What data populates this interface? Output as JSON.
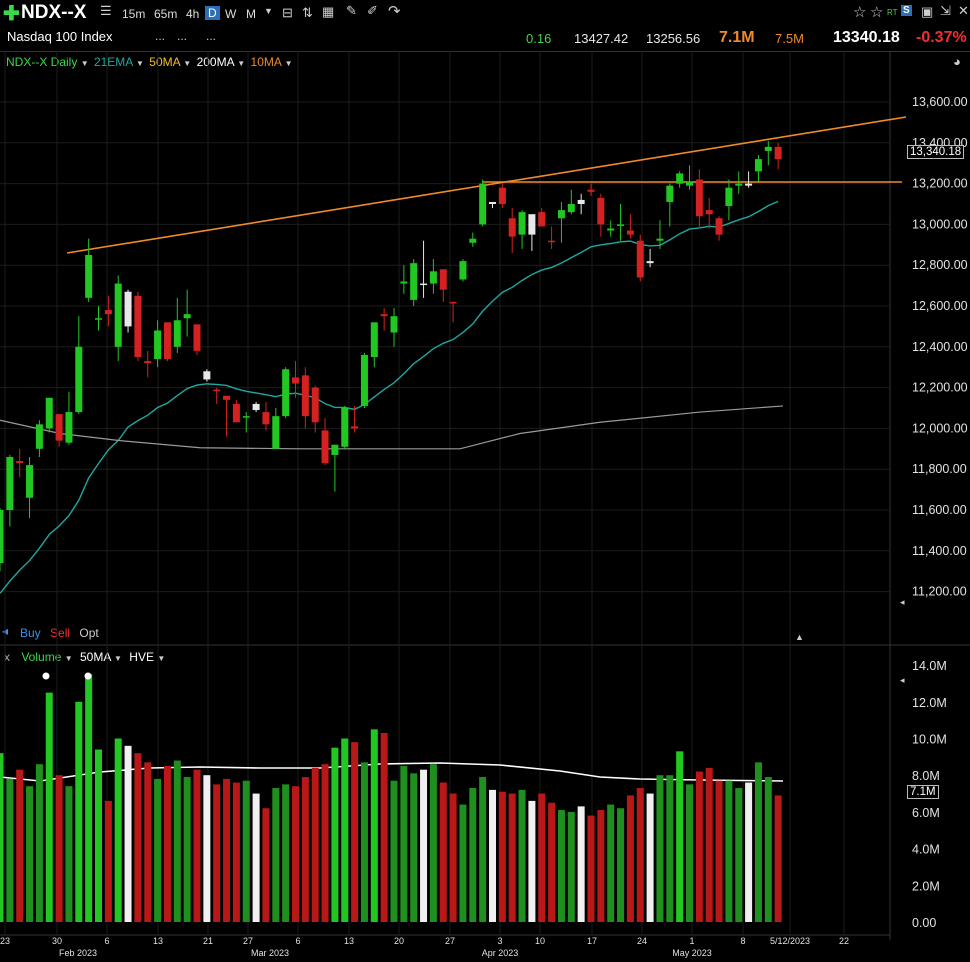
{
  "header": {
    "symbol": "NDX--X",
    "name": "Nasdaq 100 Index",
    "timeframes": [
      "15m",
      "65m",
      "4h",
      "D",
      "W",
      "M"
    ],
    "selected_timeframe": "D",
    "dots": [
      "...",
      "...",
      "..."
    ],
    "change_small": "0.16",
    "high": "13427.42",
    "low": "13256.56",
    "volume_today": "7.1M",
    "volume_avg": "7.5M",
    "last": "13340.18",
    "pct_change": "-0.37%",
    "right_icons": [
      "RT",
      "S"
    ]
  },
  "legend": {
    "symbol_label": "NDX--X Daily",
    "ma21": "21EMA",
    "ma50": "50MA",
    "ma200": "200MA",
    "ma10": "10MA"
  },
  "trade": {
    "buy": "Buy",
    "sell": "Sell",
    "opt": "Opt"
  },
  "volume_legend": {
    "close": "x",
    "volume": "Volume",
    "ma": "50MA",
    "hve": "HVE"
  },
  "price_tag": "13,340.18",
  "volume_tag": "7.1M",
  "chart_data": {
    "type": "candlestick",
    "y_ticks": [
      "13,600.00",
      "13,400.00",
      "13,200.00",
      "13,000.00",
      "12,800.00",
      "12,600.00",
      "12,400.00",
      "12,200.00",
      "12,000.00",
      "11,800.00",
      "11,600.00",
      "11,400.00",
      "11,200.00"
    ],
    "volume_ticks": [
      "14.0M",
      "12.0M",
      "10.0M",
      "8.0M",
      "6.0M",
      "4.0M",
      "2.0M",
      "0.00"
    ],
    "x_labels": [
      "23",
      "30",
      "6",
      "13",
      "21",
      "27",
      "6",
      "13",
      "20",
      "27",
      "3",
      "10",
      "17",
      "24",
      "1",
      "8",
      "5/12/2023",
      "22"
    ],
    "month_labels": [
      "Feb 2023",
      "Mar 2023",
      "Apr 2023",
      "May 2023"
    ],
    "colors": {
      "up": "#22c822",
      "down": "#d42222",
      "neutral": "#e8e8e8",
      "ema21": "#1fa7a0",
      "ma200": "#9a9a9a",
      "trendline": "#f08a2a",
      "vol_up": "#1f8f1f",
      "vol_down": "#b81818",
      "vol_ma": "#ffffff"
    },
    "candles": [
      [
        11340,
        11610,
        11300,
        11600,
        "up",
        9.2
      ],
      [
        11600,
        11870,
        11520,
        11860,
        "up",
        7.8
      ],
      [
        11830,
        11900,
        11760,
        11840,
        "down",
        8.3
      ],
      [
        11660,
        11860,
        11560,
        11820,
        "up",
        7.4
      ],
      [
        11900,
        12040,
        11860,
        12020,
        "up",
        8.6
      ],
      [
        12000,
        12150,
        11980,
        12150,
        "up",
        12.5
      ],
      [
        12070,
        12040,
        11910,
        11940,
        "down",
        8.0
      ],
      [
        11930,
        12180,
        11920,
        12080,
        "up",
        7.4
      ],
      [
        12080,
        12550,
        12070,
        12400,
        "up",
        12.0
      ],
      [
        12640,
        12930,
        12620,
        12850,
        "up",
        13.5
      ],
      [
        12540,
        12600,
        12480,
        12540,
        "up",
        9.4
      ],
      [
        12580,
        12650,
        12500,
        12560,
        "down",
        6.6
      ],
      [
        12710,
        12750,
        12330,
        12400,
        "up",
        10.0
      ],
      [
        12500,
        12680,
        12470,
        12670,
        "neutral",
        9.6
      ],
      [
        12650,
        12670,
        12330,
        12350,
        "down",
        9.2
      ],
      [
        12320,
        12380,
        12250,
        12330,
        "down",
        8.7
      ],
      [
        12340,
        12530,
        12300,
        12480,
        "up",
        7.8
      ],
      [
        12520,
        12520,
        12330,
        12340,
        "down",
        8.5
      ],
      [
        12400,
        12640,
        12370,
        12530,
        "up",
        8.8
      ],
      [
        12560,
        12680,
        12450,
        12540,
        "up",
        7.9
      ],
      [
        12510,
        12490,
        12360,
        12380,
        "down",
        8.3
      ],
      [
        12240,
        12290,
        12230,
        12280,
        "neutral",
        8.0
      ],
      [
        12190,
        12200,
        12120,
        12190,
        "down",
        7.5
      ],
      [
        12140,
        12150,
        11960,
        12160,
        "down",
        7.8
      ],
      [
        12120,
        12140,
        12030,
        12030,
        "down",
        7.6
      ],
      [
        12060,
        12080,
        11980,
        12060,
        "up",
        7.7
      ],
      [
        12120,
        12130,
        12080,
        12090,
        "neutral",
        7.0
      ],
      [
        12020,
        12130,
        11990,
        12080,
        "down",
        6.2
      ],
      [
        11900,
        12100,
        11900,
        12060,
        "up",
        7.3
      ],
      [
        12060,
        12300,
        12050,
        12290,
        "up",
        7.5
      ],
      [
        12250,
        12330,
        12150,
        12220,
        "down",
        7.4
      ],
      [
        12260,
        12300,
        12000,
        12060,
        "down",
        7.9
      ],
      [
        12200,
        12210,
        11980,
        12030,
        "down",
        8.4
      ],
      [
        11990,
        12050,
        11820,
        11830,
        "down",
        8.6
      ],
      [
        11870,
        11920,
        11690,
        11920,
        "up",
        9.5
      ],
      [
        11910,
        12110,
        11900,
        12100,
        "up",
        10.0
      ],
      [
        12010,
        12110,
        11980,
        12000,
        "down",
        9.8
      ],
      [
        12110,
        12370,
        12100,
        12360,
        "up",
        8.7
      ],
      [
        12350,
        12510,
        12300,
        12520,
        "up",
        10.5
      ],
      [
        12550,
        12590,
        12480,
        12560,
        "down",
        10.3
      ],
      [
        12470,
        12590,
        12400,
        12550,
        "up",
        7.7
      ],
      [
        12720,
        12800,
        12660,
        12710,
        "up",
        8.5
      ],
      [
        12630,
        12830,
        12600,
        12810,
        "up",
        8.1
      ],
      [
        12710,
        12920,
        12640,
        12710,
        "neutral",
        8.3
      ],
      [
        12710,
        12830,
        12660,
        12770,
        "up",
        8.6
      ],
      [
        12780,
        12760,
        12620,
        12680,
        "down",
        7.6
      ],
      [
        12620,
        12620,
        12520,
        12620,
        "down",
        7.0
      ],
      [
        12730,
        12830,
        12720,
        12820,
        "up",
        6.4
      ],
      [
        12910,
        12960,
        12890,
        12930,
        "up",
        7.3
      ],
      [
        13000,
        13220,
        12990,
        13200,
        "up",
        7.9
      ],
      [
        13100,
        13110,
        13080,
        13110,
        "neutral",
        7.2
      ],
      [
        13180,
        13200,
        13080,
        13100,
        "down",
        7.1
      ],
      [
        13030,
        13080,
        12860,
        12940,
        "down",
        7.0
      ],
      [
        12950,
        13070,
        12880,
        13060,
        "up",
        7.2
      ],
      [
        12950,
        13010,
        12870,
        13050,
        "neutral",
        6.6
      ],
      [
        13060,
        13080,
        12990,
        12990,
        "down",
        7.0
      ],
      [
        12920,
        12990,
        12880,
        12920,
        "down",
        6.5
      ],
      [
        13070,
        13110,
        12910,
        13030,
        "up",
        6.1
      ],
      [
        13060,
        13170,
        13050,
        13100,
        "up",
        6.0
      ],
      [
        13100,
        13150,
        13050,
        13120,
        "neutral",
        6.3
      ],
      [
        13170,
        13200,
        13140,
        13160,
        "down",
        5.8
      ],
      [
        13130,
        13150,
        12940,
        13000,
        "down",
        6.1
      ],
      [
        12980,
        13020,
        12940,
        12970,
        "up",
        6.4
      ],
      [
        13000,
        13100,
        12920,
        13000,
        "up",
        6.2
      ],
      [
        12970,
        13050,
        12930,
        12950,
        "down",
        6.9
      ],
      [
        12920,
        12950,
        12720,
        12740,
        "down",
        7.3
      ],
      [
        12810,
        12880,
        12790,
        12820,
        "neutral",
        7.0
      ],
      [
        12920,
        13020,
        12880,
        12930,
        "up",
        8.0
      ],
      [
        13110,
        13200,
        12990,
        13190,
        "up",
        8.0
      ],
      [
        13200,
        13260,
        13180,
        13250,
        "up",
        9.3
      ],
      [
        13190,
        13290,
        13170,
        13210,
        "up",
        7.5
      ],
      [
        13220,
        13270,
        12980,
        13040,
        "down",
        8.2
      ],
      [
        13050,
        13130,
        12980,
        13070,
        "down",
        8.4
      ],
      [
        13030,
        13040,
        12920,
        12950,
        "down",
        7.7
      ],
      [
        13090,
        13220,
        13020,
        13180,
        "up",
        7.7
      ],
      [
        13190,
        13260,
        13150,
        13200,
        "up",
        7.3
      ],
      [
        13200,
        13260,
        13180,
        13190,
        "neutral",
        7.6
      ],
      [
        13260,
        13340,
        13210,
        13320,
        "up",
        8.7
      ],
      [
        13360,
        13410,
        13290,
        13380,
        "up",
        7.9
      ],
      [
        13380,
        13400,
        13270,
        13320,
        "down",
        6.9
      ]
    ]
  }
}
